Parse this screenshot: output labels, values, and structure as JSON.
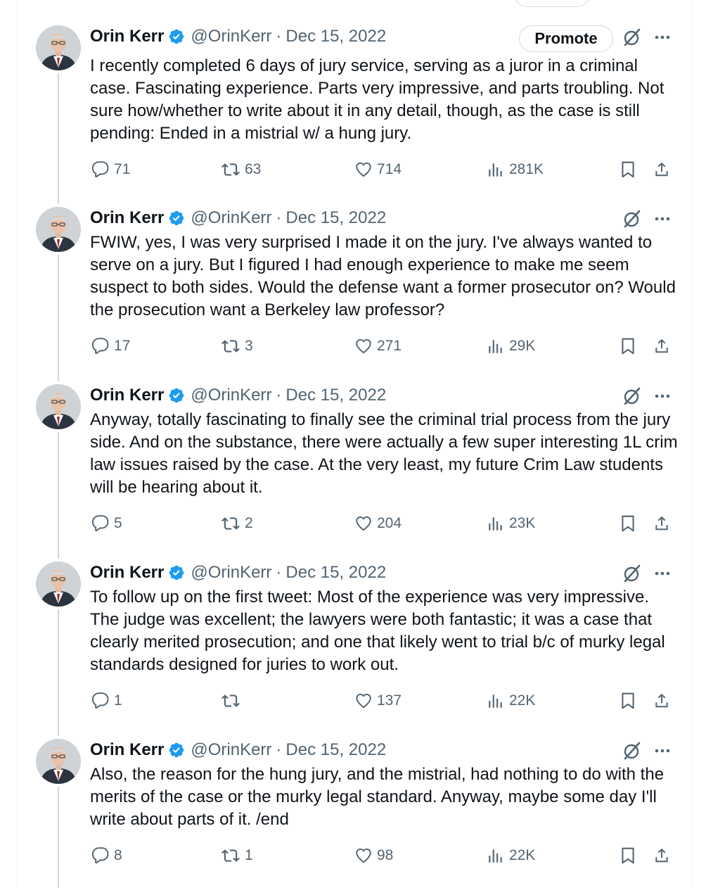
{
  "colors": {
    "text": "#0f1419",
    "secondary": "#536471",
    "verified": "#1d9bf0",
    "border": "#cfd9de"
  },
  "icons": {
    "reply": "reply-icon",
    "repost": "repost-icon",
    "like": "like-icon",
    "views": "views-icon",
    "bookmark": "bookmark-icon",
    "share": "share-icon",
    "grok": "grok-icon",
    "more": "more-icon",
    "verified": "verified-badge-icon"
  },
  "promote_label": "Promote",
  "tweets": [
    {
      "name": "Orin Kerr",
      "handle": "@OrinKerr",
      "separator": "·",
      "date": "Dec 15, 2022",
      "text": "I recently completed 6 days of jury service, serving as a juror in a criminal case. Fascinating experience. Parts very impressive, and parts troubling. Not sure how/whether to write about it in any detail, though, as the case is still pending: Ended in a mistrial w/ a hung jury.",
      "replies": "71",
      "reposts": "63",
      "likes": "714",
      "views": "281K"
    },
    {
      "name": "Orin Kerr",
      "handle": "@OrinKerr",
      "separator": "·",
      "date": "Dec 15, 2022",
      "text": "FWIW, yes, I was very surprised I made it on the jury.  I've always wanted to serve on a jury. But I figured I had enough experience to make me seem suspect to both sides.  Would the defense want a former prosecutor on? Would the prosecution want a Berkeley law professor?",
      "replies": "17",
      "reposts": "3",
      "likes": "271",
      "views": "29K"
    },
    {
      "name": "Orin Kerr",
      "handle": "@OrinKerr",
      "separator": "·",
      "date": "Dec 15, 2022",
      "text": "Anyway, totally fascinating to finally see the criminal trial process from the jury side.  And on the substance,  there were actually a few super interesting 1L crim law issues raised by the case. At the very least, my future Crim Law students will be hearing about it.",
      "replies": "5",
      "reposts": "2",
      "likes": "204",
      "views": "23K"
    },
    {
      "name": "Orin Kerr",
      "handle": "@OrinKerr",
      "separator": "·",
      "date": "Dec 15, 2022",
      "text": "To follow up on the first tweet: Most of the experience was very impressive. The judge was excellent; the lawyers were both fantastic; it was a case that clearly merited prosecution; and one that likely went to trial b/c of murky legal standards designed for juries to work out.",
      "replies": "1",
      "reposts": "",
      "likes": "137",
      "views": "22K"
    },
    {
      "name": "Orin Kerr",
      "handle": "@OrinKerr",
      "separator": "·",
      "date": "Dec 15, 2022",
      "text": "Also, the reason for the hung jury, and the mistrial, had nothing to do with the merits of the case or the murky legal standard. Anyway, maybe some day I'll write about parts of it.  /end",
      "replies": "8",
      "reposts": "1",
      "likes": "98",
      "views": "22K"
    }
  ]
}
